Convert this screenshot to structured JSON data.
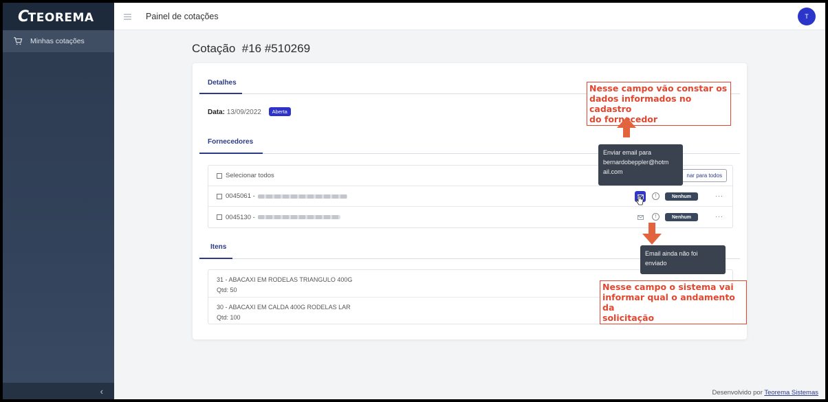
{
  "brand": {
    "logo_text": "TEOREMA"
  },
  "sidebar": {
    "items": [
      {
        "label": "Minhas cotações",
        "icon": "cart-icon"
      }
    ],
    "collapse_glyph": "‹"
  },
  "topbar": {
    "title": "Painel de cotações",
    "avatar_initial": "T"
  },
  "page": {
    "title": "Cotação  #16 #510269"
  },
  "detalhes": {
    "tab_label": "Detalhes",
    "data_label": "Data:",
    "data_value": "13/09/2022",
    "status_badge": "Aberta"
  },
  "fornecedores": {
    "tab_label": "Fornecedores",
    "select_all": "Selecionar todos",
    "send_all_button": "nar para todos",
    "rows": [
      {
        "code": "0045061 - ",
        "status": "Nenhum",
        "more": "···"
      },
      {
        "code": "0045130 - ",
        "status": "Nenhum",
        "more": "···"
      }
    ]
  },
  "itens": {
    "tab_label": "Itens",
    "rows": [
      {
        "name": "31 - ABACAXI EM RODELAS TRIANGULO 400G",
        "qty": "Qtd: 50"
      },
      {
        "name": "30 - ABACAXI EM CALDA 400G RODELAS LAR",
        "qty": "Qtd: 100"
      }
    ]
  },
  "tooltips": {
    "send_email": [
      "Enviar email para",
      "bernardobeppler@hotm",
      "ail.com"
    ],
    "not_sent": [
      "Email ainda não foi",
      "enviado"
    ]
  },
  "annotations": {
    "top": [
      "Nesse campo vão constar os",
      "dados informados no cadastro",
      "do fornecedor"
    ],
    "bottom": [
      "Nesse campo o sistema vai",
      "informar qual o andamento da",
      "solicitação"
    ]
  },
  "footer": {
    "text": "Desenvolvido por ",
    "link": "Teorema Sistemas"
  },
  "colors": {
    "accent": "#2d33c8",
    "sidebar": "#2c3a4e",
    "annotation": "#e2462e",
    "status_badge": "#38475c"
  }
}
